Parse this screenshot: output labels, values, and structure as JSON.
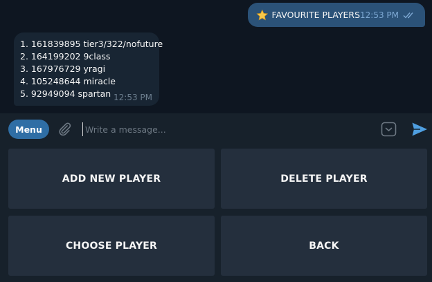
{
  "messages": {
    "outgoing": {
      "text": "FAVOURITE PLAYERS",
      "time": "12:53 PM",
      "icon": "star-emoji"
    },
    "incoming": {
      "lines": [
        "1. 161839895 tier3/322/nofuture",
        "2. 164199202 9class",
        "3. 167976729 yragi",
        "4. 105248644 miracle",
        "5. 92949094 spartan"
      ],
      "time": "12:53 PM"
    }
  },
  "composer": {
    "menu_label": "Menu",
    "placeholder": "Write a message...",
    "icons": [
      "paperclip-icon",
      "bot-keyboard-icon",
      "send-icon"
    ]
  },
  "keyboard": {
    "buttons": [
      "ADD NEW PLAYER",
      "DELETE PLAYER",
      "CHOOSE PLAYER",
      "BACK"
    ]
  },
  "colors": {
    "chat_bg": "#0e1621",
    "outgoing_bubble": "#2b5278",
    "incoming_bubble": "#182533",
    "panel_bg": "#17212b",
    "button_bg": "#242f3d",
    "accent": "#2f6ea5",
    "send_blue": "#4f9fe0"
  }
}
